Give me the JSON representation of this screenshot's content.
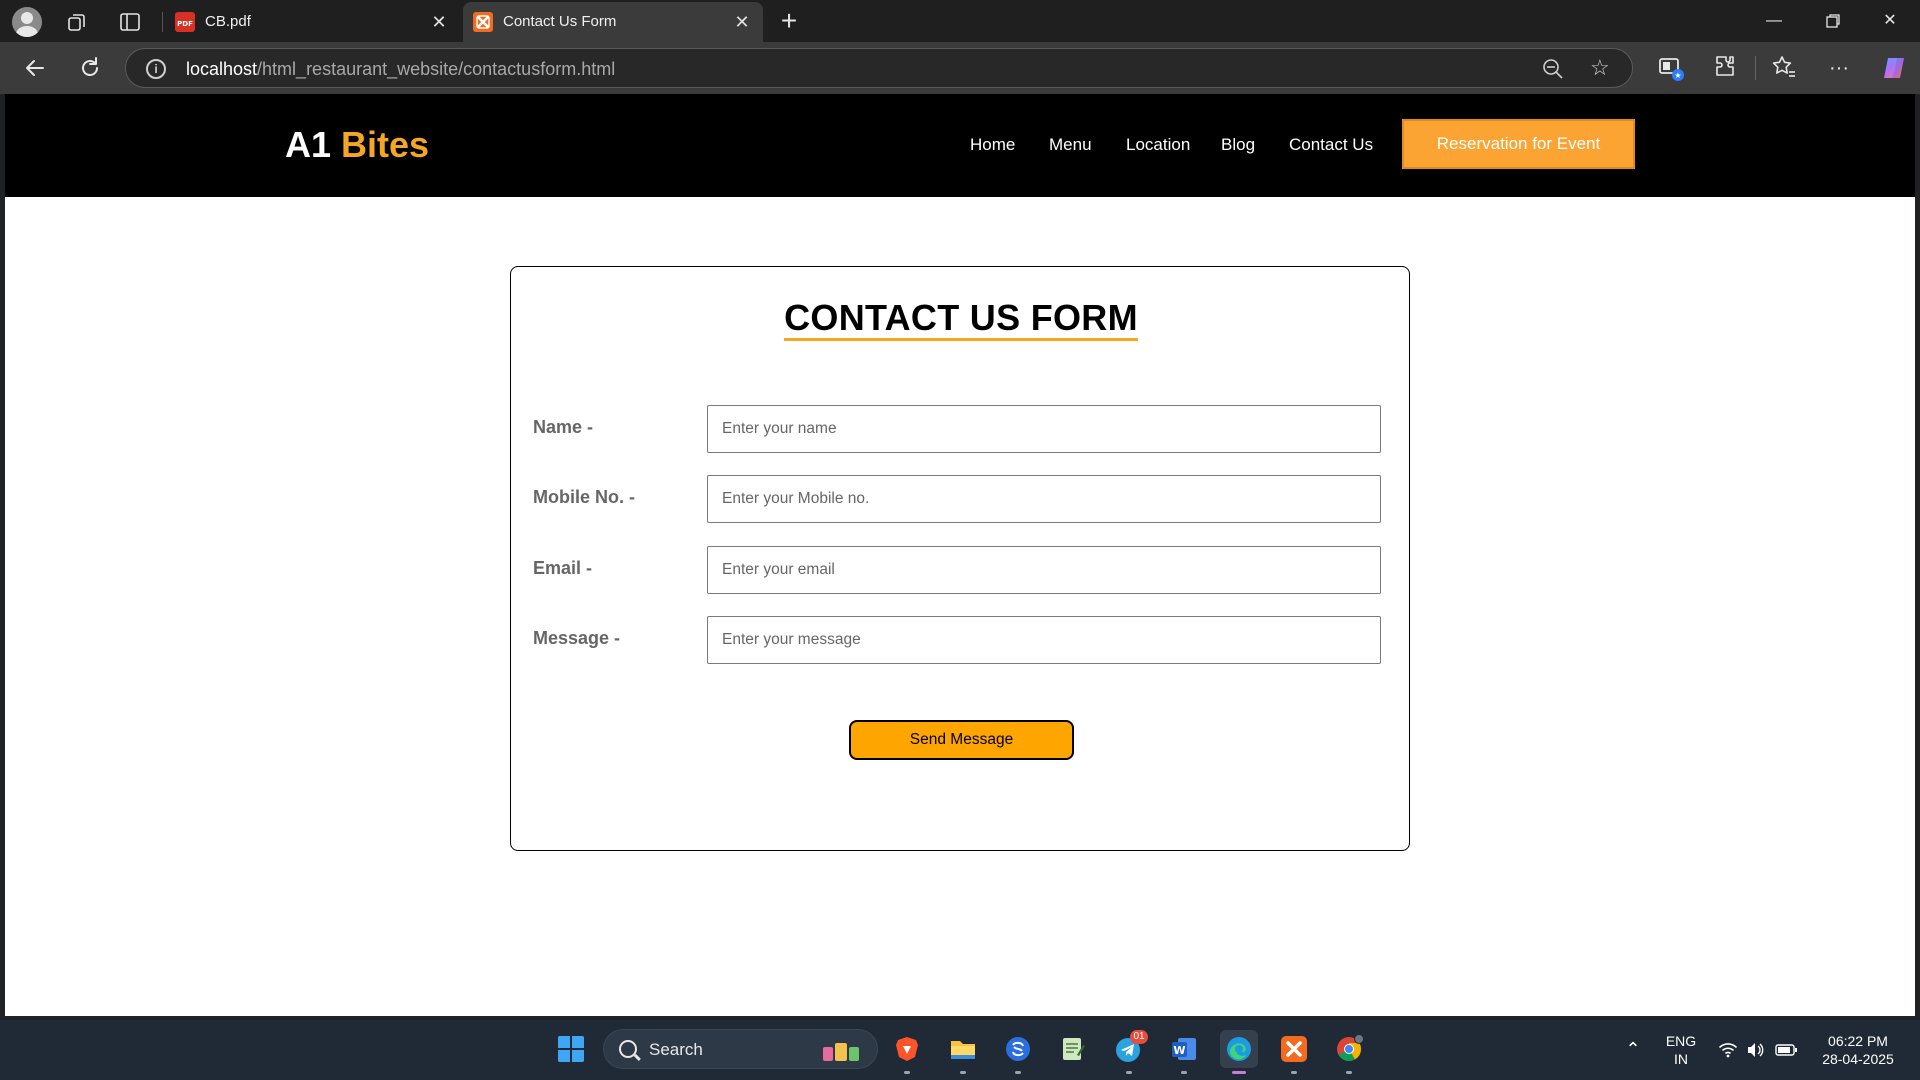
{
  "browser": {
    "tabs": [
      {
        "title": "CB.pdf",
        "icon": "pdf-icon",
        "active": false
      },
      {
        "title": "Contact Us Form",
        "icon": "xampp-icon",
        "active": true
      }
    ],
    "address": {
      "host": "localhost",
      "path": "/html_restaurant_website/contactusform.html"
    }
  },
  "site": {
    "logo_main": "A1",
    "logo_accent": "Bites",
    "accent_color": "#f5a623",
    "nav": [
      "Home",
      "Menu",
      "Location",
      "Blog",
      "Contact Us"
    ],
    "cta_label": "Reservation for Event"
  },
  "form": {
    "title": "CONTACT US FORM",
    "fields": [
      {
        "label": "Name -",
        "placeholder": "Enter your name"
      },
      {
        "label": "Mobile No. -",
        "placeholder": "Enter your Mobile no."
      },
      {
        "label": "Email -",
        "placeholder": "Enter your email"
      },
      {
        "label": "Message -",
        "placeholder": "Enter your message"
      }
    ],
    "submit_label": "Send Message"
  },
  "taskbar": {
    "search_label": "Search",
    "apps": [
      "windows-start-icon",
      "brave-icon",
      "file-explorer-icon",
      "simplenote-icon",
      "notepad-icon",
      "telegram-icon",
      "word-icon",
      "edge-icon",
      "xampp-icon",
      "chrome-icon"
    ],
    "telegram_badge": "01",
    "language": "ENG",
    "region": "IN",
    "time": "06:22 PM",
    "date": "28-04-2025"
  }
}
